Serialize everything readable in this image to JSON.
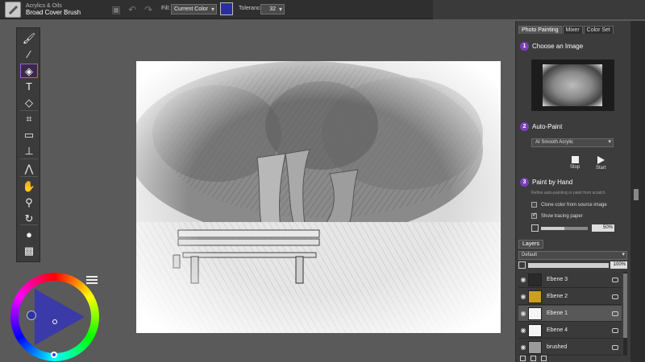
{
  "toolbar": {
    "brush_category": "Acrylics & Oils",
    "brush_name": "Broad Cover Brush",
    "icons": [
      "save-icon",
      "undo-icon",
      "redo-icon"
    ],
    "fill_label": "Fill:",
    "fill_value": "Current Color",
    "current_color": "#2a2ea0",
    "tolerance_label": "Tolerance:",
    "tolerance_value": "32"
  },
  "tools": [
    {
      "name": "brush-tool-icon",
      "glyph": "🖌",
      "active": false
    },
    {
      "name": "dropper-tool-icon",
      "glyph": "⁄",
      "active": false
    },
    {
      "name": "paint-bucket-tool-icon",
      "glyph": "◈",
      "active": true
    },
    {
      "name": "text-tool-icon",
      "glyph": "T",
      "active": false
    },
    {
      "name": "eraser-tool-icon",
      "glyph": "◇",
      "active": false
    },
    {
      "name": "crop-tool-icon",
      "glyph": "⌗",
      "active": false
    },
    {
      "name": "rectangle-select-tool-icon",
      "glyph": "▭",
      "active": false
    },
    {
      "name": "transform-tool-icon",
      "glyph": "⊥",
      "active": false
    },
    {
      "name": "mirror-tool-icon",
      "glyph": "⋀",
      "active": false
    },
    {
      "name": "grabber-tool-icon",
      "glyph": "✋",
      "active": false
    },
    {
      "name": "magnifier-tool-icon",
      "glyph": "⚲",
      "active": false
    },
    {
      "name": "rotate-page-tool-icon",
      "glyph": "↻",
      "active": false
    },
    {
      "name": "color-swatch-tool-icon",
      "glyph": "●",
      "active": false
    },
    {
      "name": "paper-texture-tool-icon",
      "glyph": "▩",
      "active": false
    }
  ],
  "right_panel": {
    "tabs": [
      "Photo Painting",
      "Mixer",
      "Color Set"
    ],
    "step1": {
      "num": "1",
      "title": "Choose an Image"
    },
    "step2": {
      "num": "2",
      "title": "Auto-Paint"
    },
    "autopaint_style": "AI Smooth Acrylic",
    "stop_label": "Stop",
    "start_label": "Start",
    "step3": {
      "num": "3",
      "title": "Paint by Hand"
    },
    "step3_hint": "Refine auto-painting or paint from scratch",
    "clone_color_label": "Clone color from source image",
    "clone_color_checked": false,
    "tracing_paper_label": "Show tracing paper",
    "tracing_paper_checked": true,
    "tracing_opacity": "50%",
    "tracing_opacity_fraction": 0.5
  },
  "layers": {
    "tab_label": "Layers",
    "composite_method": "Default",
    "opacity": "100%",
    "opacity_fraction": 1.0,
    "items": [
      {
        "name": "Ebene 3",
        "thumb": "#2a2a2a",
        "selected": false
      },
      {
        "name": "Ebene 2",
        "thumb": "#c9a020",
        "selected": false
      },
      {
        "name": "Ebene 1",
        "thumb": "#f5f5f5",
        "selected": true
      },
      {
        "name": "Ebene 4",
        "thumb": "#f5f5f5",
        "selected": false
      },
      {
        "name": "brushed",
        "thumb": "#9a9a9a",
        "selected": false
      }
    ]
  }
}
